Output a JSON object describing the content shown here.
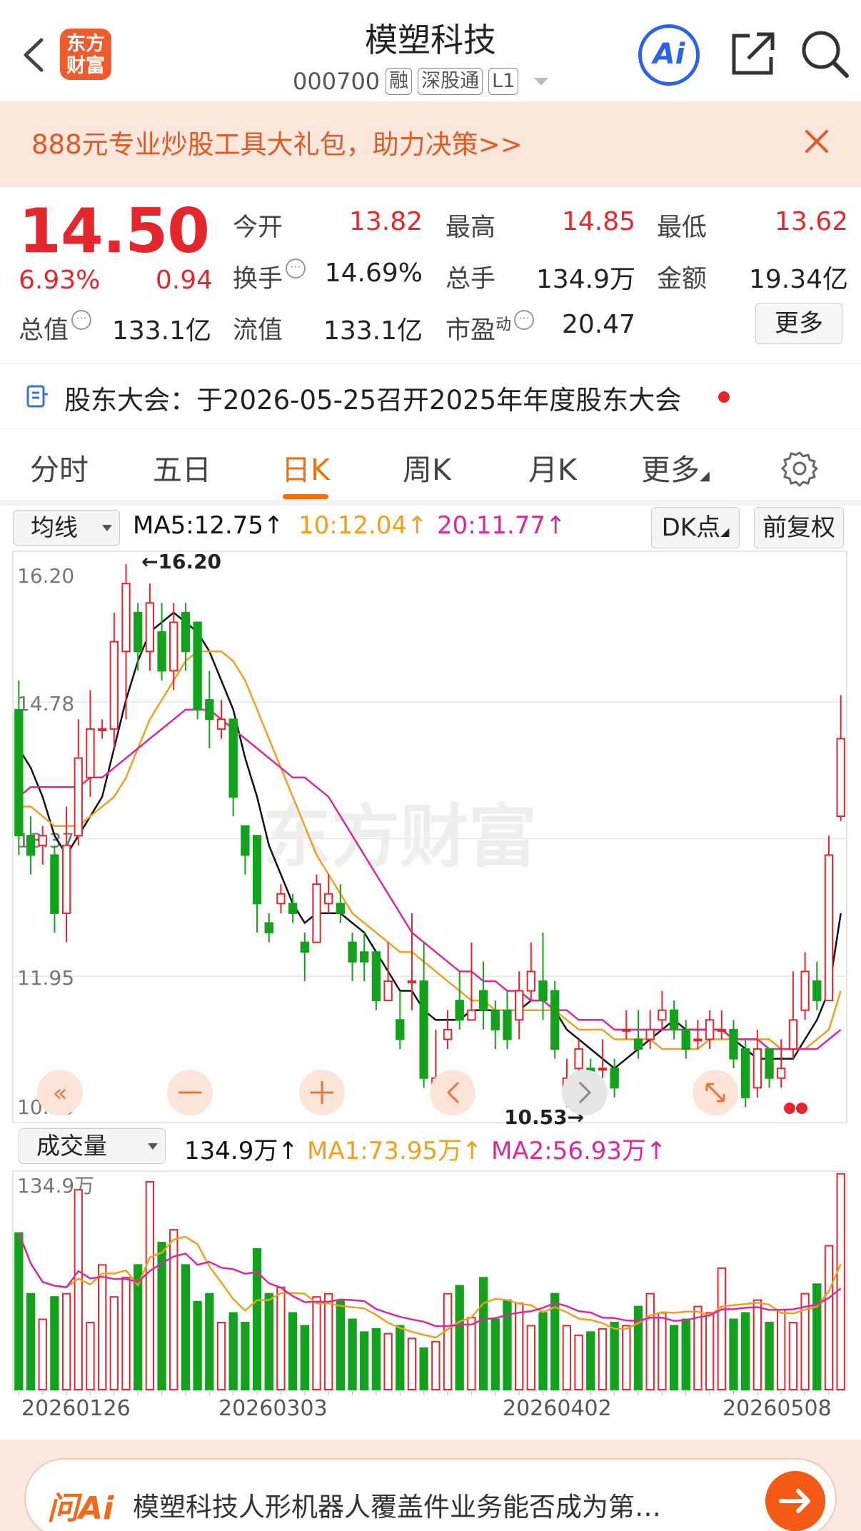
{
  "header": {
    "logo_line1": "东方",
    "logo_line2": "财富",
    "title": "模塑科技",
    "code": "000700",
    "tags": [
      "融",
      "深股通",
      "L1"
    ],
    "ai_label": "Ai"
  },
  "promo": {
    "text": "888元专业炒股工具大礼包，助力决策>>"
  },
  "quote": {
    "price": "14.50",
    "change_pct": "6.93%",
    "change": "0.94",
    "stats": [
      {
        "label": "今开",
        "value": "13.82",
        "color": "red"
      },
      {
        "label": "最高",
        "value": "14.85",
        "color": "red"
      },
      {
        "label": "最低",
        "value": "13.62",
        "color": "red"
      },
      {
        "label": "换手",
        "value": "14.69%",
        "color": "dark"
      },
      {
        "label": "总手",
        "value": "134.9万",
        "color": "dark"
      },
      {
        "label": "金额",
        "value": "19.34亿",
        "color": "dark"
      },
      {
        "label": "总值",
        "value": "133.1亿",
        "color": "dark"
      },
      {
        "label": "流值",
        "value": "133.1亿",
        "color": "dark"
      },
      {
        "label": "市盈",
        "sup": "动",
        "value": "20.47",
        "color": "dark"
      }
    ],
    "more_label": "更多"
  },
  "notice": {
    "text": "股东大会：于2026-05-25召开2025年年度股东大会"
  },
  "tabs": [
    {
      "label": "分时",
      "active": false
    },
    {
      "label": "五日",
      "active": false
    },
    {
      "label": "日K",
      "active": true
    },
    {
      "label": "周K",
      "active": false
    },
    {
      "label": "月K",
      "active": false
    },
    {
      "label": "更多",
      "active": false
    }
  ],
  "indicators": {
    "selector": "均线",
    "ma5": "MA5:12.75",
    "ma10": "10:12.04",
    "ma20": "20:11.77",
    "dk_label": "DK点",
    "fq_label": "前复权"
  },
  "volume_row": {
    "selector": "成交量",
    "vol": "134.9万",
    "ma1": "MA1:73.95万",
    "ma2": "MA2:56.93万"
  },
  "colors": {
    "up": "#e4262d",
    "down": "#14a11e",
    "ma5": "#111111",
    "ma10": "#f0a020",
    "ma20": "#d82a9e",
    "accent": "#f0720f"
  },
  "chart_data": {
    "type": "candlestick",
    "y_ticks": [
      "16.20",
      "14.78",
      "13.37",
      "11.95",
      "10.53"
    ],
    "ylim": [
      10.53,
      16.2
    ],
    "annotations": {
      "high": "←16.20",
      "low": "10.53→"
    },
    "watermark": "东方财富",
    "x_labels": [
      "20260126",
      "20260303",
      "20260402",
      "20260508"
    ],
    "candles": [
      [
        14.7,
        13.4,
        15.0,
        13.2
      ],
      [
        13.4,
        13.2,
        13.6,
        13.0
      ],
      [
        13.3,
        13.4,
        13.5,
        13.1
      ],
      [
        13.2,
        12.6,
        13.3,
        12.4
      ],
      [
        12.6,
        13.3,
        13.7,
        12.3
      ],
      [
        13.4,
        14.2,
        14.6,
        13.3
      ],
      [
        14.0,
        14.5,
        14.9,
        13.8
      ],
      [
        14.5,
        14.5,
        14.6,
        14.4
      ],
      [
        14.5,
        15.4,
        15.7,
        14.3
      ],
      [
        15.3,
        16.0,
        16.2,
        14.6
      ],
      [
        15.7,
        15.3,
        15.8,
        15.1
      ],
      [
        15.3,
        15.8,
        16.0,
        15.1
      ],
      [
        15.5,
        15.1,
        15.8,
        15.0
      ],
      [
        15.1,
        15.6,
        15.8,
        14.9
      ],
      [
        15.7,
        15.3,
        15.8,
        15.1
      ],
      [
        15.6,
        14.7,
        15.6,
        14.6
      ],
      [
        14.8,
        14.6,
        15.1,
        14.3
      ],
      [
        14.5,
        14.6,
        14.8,
        14.4
      ],
      [
        14.6,
        13.8,
        14.6,
        13.6
      ],
      [
        13.5,
        13.2,
        13.5,
        13.0
      ],
      [
        13.4,
        12.7,
        13.4,
        12.4
      ],
      [
        12.5,
        12.4,
        12.6,
        12.3
      ],
      [
        12.7,
        12.8,
        12.9,
        12.6
      ],
      [
        12.7,
        12.6,
        12.8,
        12.5
      ],
      [
        12.3,
        12.2,
        12.4,
        11.9
      ],
      [
        12.3,
        12.9,
        13.0,
        12.3
      ],
      [
        12.7,
        12.8,
        13.0,
        12.6
      ],
      [
        12.7,
        12.6,
        12.9,
        12.5
      ],
      [
        12.3,
        12.1,
        12.4,
        11.9
      ],
      [
        12.2,
        12.1,
        12.4,
        11.9
      ],
      [
        12.2,
        11.7,
        12.2,
        11.6
      ],
      [
        11.7,
        11.9,
        12.3,
        11.7
      ],
      [
        11.5,
        11.3,
        11.8,
        11.2
      ],
      [
        11.9,
        11.9,
        12.6,
        11.6
      ],
      [
        11.9,
        10.9,
        12.3,
        10.8
      ],
      [
        10.8,
        10.9,
        11.4,
        10.7
      ],
      [
        11.3,
        11.4,
        11.6,
        11.2
      ],
      [
        11.7,
        11.5,
        12.0,
        11.4
      ],
      [
        11.5,
        11.6,
        12.3,
        11.5
      ],
      [
        11.8,
        11.6,
        12.1,
        11.4
      ],
      [
        11.6,
        11.4,
        11.7,
        11.2
      ],
      [
        11.6,
        11.3,
        11.8,
        11.2
      ],
      [
        11.5,
        11.8,
        12.0,
        11.3
      ],
      [
        11.8,
        12.0,
        12.3,
        11.7
      ],
      [
        11.9,
        11.7,
        12.4,
        11.5
      ],
      [
        11.8,
        11.2,
        11.9,
        11.1
      ],
      [
        10.8,
        10.9,
        11.1,
        10.6
      ],
      [
        11.0,
        11.2,
        11.3,
        10.7
      ],
      [
        11.0,
        10.9,
        11.1,
        10.8
      ],
      [
        11.0,
        11.0,
        11.3,
        10.9
      ],
      [
        11.0,
        10.8,
        11.1,
        10.7
      ],
      [
        11.4,
        11.4,
        11.6,
        11.3
      ],
      [
        11.3,
        11.2,
        11.6,
        11.1
      ],
      [
        11.3,
        11.4,
        11.6,
        11.2
      ],
      [
        11.5,
        11.6,
        11.8,
        11.4
      ],
      [
        11.6,
        11.4,
        11.7,
        11.3
      ],
      [
        11.4,
        11.2,
        11.5,
        11.1
      ],
      [
        11.3,
        11.3,
        11.5,
        11.2
      ],
      [
        11.3,
        11.5,
        11.6,
        11.2
      ],
      [
        11.4,
        11.4,
        11.6,
        11.3
      ],
      [
        11.4,
        11.1,
        11.5,
        11.0
      ],
      [
        11.2,
        10.7,
        11.3,
        10.6
      ],
      [
        10.8,
        11.2,
        11.4,
        10.7
      ],
      [
        11.2,
        10.9,
        11.2,
        10.8
      ],
      [
        10.9,
        11.0,
        11.3,
        10.8
      ],
      [
        11.2,
        11.5,
        12.0,
        11.1
      ],
      [
        11.6,
        12.0,
        12.2,
        11.5
      ],
      [
        11.9,
        11.7,
        12.1,
        11.6
      ],
      [
        11.7,
        13.2,
        13.4,
        11.7
      ],
      [
        13.6,
        14.4,
        14.85,
        13.55
      ]
    ],
    "ma_series": {
      "MA5": [
        14.3,
        14.1,
        13.8,
        13.4,
        13.2,
        13.4,
        13.6,
        13.8,
        14.3,
        14.8,
        15.2,
        15.5,
        15.6,
        15.7,
        15.6,
        15.5,
        15.3,
        15.0,
        14.7,
        14.2,
        13.8,
        13.3,
        13.0,
        12.7,
        12.5,
        12.6,
        12.6,
        12.6,
        12.5,
        12.4,
        12.2,
        12.0,
        11.8,
        11.8,
        11.6,
        11.5,
        11.5,
        11.5,
        11.6,
        11.6,
        11.6,
        11.6,
        11.6,
        11.7,
        11.7,
        11.6,
        11.4,
        11.3,
        11.2,
        11.1,
        11.0,
        11.1,
        11.2,
        11.3,
        11.4,
        11.5,
        11.4,
        11.4,
        11.4,
        11.4,
        11.3,
        11.2,
        11.1,
        11.1,
        11.1,
        11.1,
        11.3,
        11.5,
        11.8,
        12.6
      ],
      "MA10": [
        13.7,
        13.7,
        13.6,
        13.5,
        13.5,
        13.5,
        13.6,
        13.7,
        13.8,
        14.0,
        14.3,
        14.6,
        14.8,
        15.0,
        15.2,
        15.3,
        15.3,
        15.3,
        15.2,
        15.0,
        14.7,
        14.4,
        14.1,
        13.8,
        13.5,
        13.2,
        13.0,
        12.8,
        12.6,
        12.5,
        12.4,
        12.3,
        12.2,
        12.2,
        12.1,
        12.0,
        11.9,
        11.8,
        11.7,
        11.7,
        11.6,
        11.6,
        11.6,
        11.6,
        11.6,
        11.6,
        11.5,
        11.4,
        11.4,
        11.4,
        11.3,
        11.3,
        11.3,
        11.3,
        11.2,
        11.2,
        11.2,
        11.2,
        11.3,
        11.3,
        11.3,
        11.3,
        11.3,
        11.3,
        11.2,
        11.2,
        11.2,
        11.3,
        11.4,
        11.8
      ],
      "MA20": [
        13.8,
        13.9,
        13.9,
        13.9,
        13.9,
        13.9,
        14.0,
        14.0,
        14.1,
        14.2,
        14.3,
        14.4,
        14.5,
        14.6,
        14.7,
        14.7,
        14.7,
        14.6,
        14.5,
        14.4,
        14.3,
        14.2,
        14.1,
        14.0,
        14.0,
        13.9,
        13.8,
        13.6,
        13.4,
        13.2,
        13.0,
        12.8,
        12.6,
        12.4,
        12.3,
        12.2,
        12.1,
        12.0,
        12.0,
        11.9,
        11.9,
        11.8,
        11.8,
        11.7,
        11.7,
        11.6,
        11.6,
        11.5,
        11.5,
        11.5,
        11.4,
        11.4,
        11.4,
        11.4,
        11.4,
        11.4,
        11.4,
        11.4,
        11.4,
        11.4,
        11.3,
        11.3,
        11.3,
        11.2,
        11.2,
        11.2,
        11.2,
        11.2,
        11.3,
        11.4
      ]
    },
    "volume": {
      "y_tick": "134.9万",
      "ymax": 134.9,
      "values": [
        98,
        60,
        44,
        58,
        60,
        125,
        42,
        78,
        58,
        70,
        78,
        130,
        92,
        100,
        78,
        55,
        60,
        42,
        48,
        42,
        88,
        60,
        64,
        48,
        40,
        58,
        60,
        56,
        44,
        36,
        38,
        35,
        40,
        32,
        26,
        30,
        60,
        65,
        45,
        70,
        44,
        56,
        54,
        40,
        48,
        60,
        40,
        34,
        36,
        38,
        42,
        40,
        52,
        60,
        48,
        40,
        44,
        52,
        48,
        76,
        44,
        48,
        56,
        42,
        50,
        42,
        60,
        66,
        90,
        135
      ]
    }
  },
  "ask": {
    "logo": "问Ai",
    "text": "模塑科技人形机器人覆盖件业务能否成为第…"
  }
}
